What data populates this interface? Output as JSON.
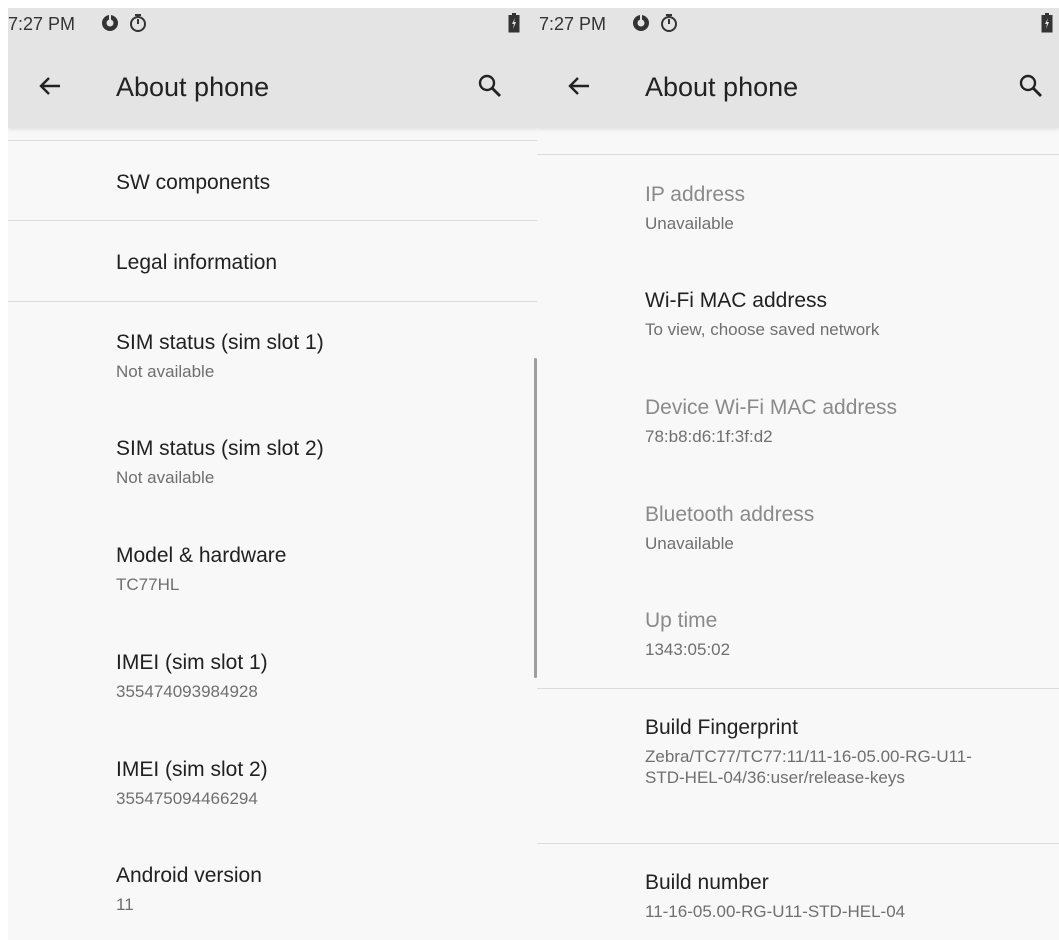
{
  "left": {
    "status": {
      "time": "7:27 PM",
      "icons": [
        "data-saver-icon",
        "timer-icon",
        "battery-icon"
      ]
    },
    "appbar": {
      "title": "About phone"
    },
    "items": [
      {
        "title": "SW components"
      },
      {
        "title": "Legal information"
      },
      {
        "title": "SIM status (sim slot 1)",
        "subtitle": "Not available"
      },
      {
        "title": "SIM status (sim slot 2)",
        "subtitle": "Not available"
      },
      {
        "title": "Model & hardware",
        "subtitle": "TC77HL"
      },
      {
        "title": "IMEI (sim slot 1)",
        "subtitle": "355474093984928"
      },
      {
        "title": "IMEI (sim slot 2)",
        "subtitle": "355475094466294"
      },
      {
        "title": "Android version",
        "subtitle": "11"
      }
    ]
  },
  "right": {
    "status": {
      "time": "7:27 PM",
      "icons": [
        "data-saver-icon",
        "timer-icon",
        "battery-icon"
      ]
    },
    "appbar": {
      "title": "About phone"
    },
    "items": [
      {
        "title": "IP address",
        "subtitle": "Unavailable"
      },
      {
        "title": "Wi-Fi MAC address",
        "subtitle": "To view, choose saved network"
      },
      {
        "title": "Device Wi-Fi MAC address",
        "subtitle": "78:b8:d6:1f:3f:d2"
      },
      {
        "title": "Bluetooth address",
        "subtitle": "Unavailable"
      },
      {
        "title": "Up time",
        "subtitle": "1343:05:02"
      },
      {
        "title": "Build Fingerprint",
        "subtitle": "Zebra/TC77/TC77:11/11-16-05.00-RG-U11-STD-HEL-04/36:user/release-keys"
      },
      {
        "title": "Build number",
        "subtitle": "11-16-05.00-RG-U11-STD-HEL-04"
      }
    ]
  },
  "colors": {
    "appbar_bg": "#e4e4e4",
    "page_bg": "#f8f8f8",
    "divider": "#dcdcdc",
    "text_primary": "#212121",
    "text_secondary": "#6f6f6f",
    "text_disabled": "#8a8a8a"
  }
}
